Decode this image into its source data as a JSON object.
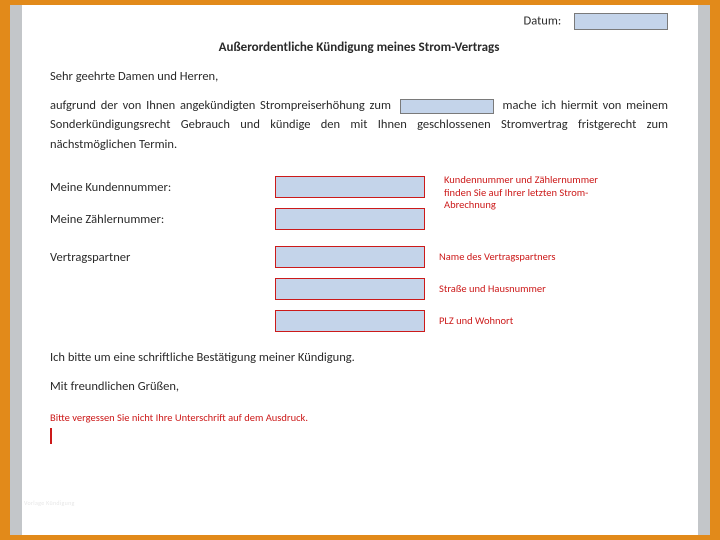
{
  "header": {
    "date_label": "Datum:"
  },
  "title": "Außerordentliche Kündigung meines Strom-Vertrags",
  "salutation": "Sehr geehrte Damen und Herren,",
  "body": {
    "part1": "aufgrund der von Ihnen angekündigten Strompreiserhöhung zum",
    "part2": "mache ich hiermit von meinem Sonderkündigungsrecht Gebrauch und kündige den mit Ihnen geschlossenen Stromvertrag fristgerecht zum nächstmöglichen Termin."
  },
  "fields": {
    "kundennummer_label": "Meine Kundennummer:",
    "zaehlernummer_label": "Meine Zählernummer:",
    "vertragspartner_label": "Vertragspartner"
  },
  "notes": {
    "kunde_zaehler": "Kundennummer und Zählernummer finden Sie auf Ihrer letzten Strom-Abrechnung",
    "partner_name": "Name des Vertragspartners",
    "partner_strasse": "Straße und Hausnummer",
    "partner_plz": "PLZ und Wohnort",
    "signature": "Bitte vergessen Sie nicht Ihre Unterschrift auf dem Ausdruck."
  },
  "closing": {
    "confirm": "Ich bitte um eine schriftliche Bestätigung meiner Kündigung.",
    "greet": "Mit freundlichen Grüßen,"
  },
  "watermark": "Vorlage Kündigung"
}
